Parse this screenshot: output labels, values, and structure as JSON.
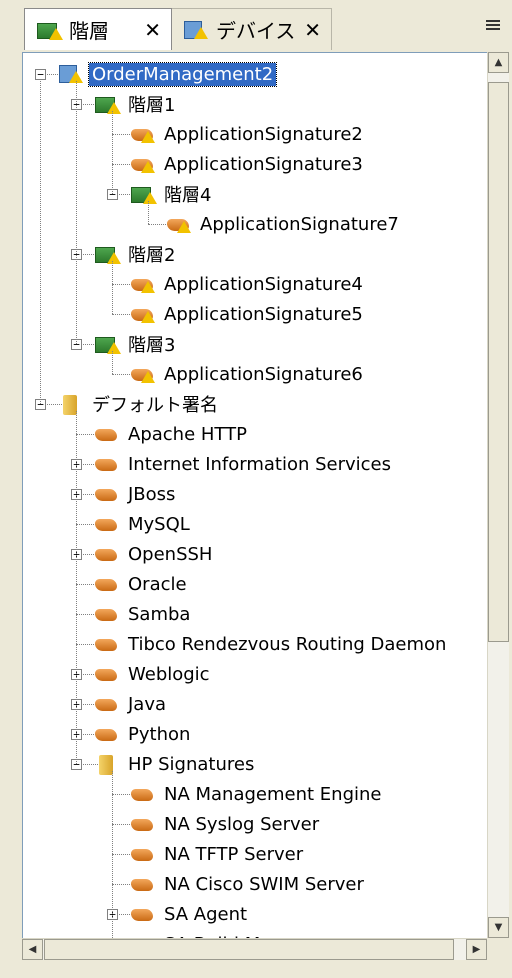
{
  "tabs": [
    {
      "label": "階層",
      "icon": "hierarchy-icon",
      "close": "✕"
    },
    {
      "label": "デバイス",
      "icon": "device-icon",
      "close": "✕"
    }
  ],
  "tree": [
    {
      "label": "OrderManagement2",
      "depth": 0,
      "icon": "root",
      "expand": "−",
      "selected": true
    },
    {
      "label": "階層1",
      "depth": 1,
      "icon": "stack",
      "expand": "−"
    },
    {
      "label": "ApplicationSignature2",
      "depth": 2,
      "icon": "sigwarn"
    },
    {
      "label": "ApplicationSignature3",
      "depth": 2,
      "icon": "sigwarn"
    },
    {
      "label": "階層4",
      "depth": 2,
      "icon": "stack",
      "expand": "−"
    },
    {
      "label": "ApplicationSignature7",
      "depth": 3,
      "icon": "sigwarn"
    },
    {
      "label": "階層2",
      "depth": 1,
      "icon": "stack",
      "expand": "−"
    },
    {
      "label": "ApplicationSignature4",
      "depth": 2,
      "icon": "sigwarn"
    },
    {
      "label": "ApplicationSignature5",
      "depth": 2,
      "icon": "sigwarn"
    },
    {
      "label": "階層3",
      "depth": 1,
      "icon": "stack",
      "expand": "−"
    },
    {
      "label": "ApplicationSignature6",
      "depth": 2,
      "icon": "sigwarn"
    },
    {
      "label": "デフォルト署名",
      "depth": 0,
      "icon": "folder",
      "expand": "−"
    },
    {
      "label": "Apache HTTP",
      "depth": 1,
      "icon": "sig"
    },
    {
      "label": "Internet Information Services",
      "depth": 1,
      "icon": "sig",
      "expand": "+"
    },
    {
      "label": "JBoss",
      "depth": 1,
      "icon": "sig",
      "expand": "+"
    },
    {
      "label": "MySQL",
      "depth": 1,
      "icon": "sig"
    },
    {
      "label": "OpenSSH",
      "depth": 1,
      "icon": "sig",
      "expand": "+"
    },
    {
      "label": "Oracle",
      "depth": 1,
      "icon": "sig"
    },
    {
      "label": "Samba",
      "depth": 1,
      "icon": "sig"
    },
    {
      "label": "Tibco Rendezvous Routing Daemon",
      "depth": 1,
      "icon": "sig"
    },
    {
      "label": "Weblogic",
      "depth": 1,
      "icon": "sig",
      "expand": "+"
    },
    {
      "label": "Java",
      "depth": 1,
      "icon": "sig",
      "expand": "+"
    },
    {
      "label": "Python",
      "depth": 1,
      "icon": "sig",
      "expand": "+"
    },
    {
      "label": "HP Signatures",
      "depth": 1,
      "icon": "folder",
      "expand": "−"
    },
    {
      "label": "NA Management Engine",
      "depth": 2,
      "icon": "sig"
    },
    {
      "label": "NA Syslog Server",
      "depth": 2,
      "icon": "sig"
    },
    {
      "label": "NA TFTP Server",
      "depth": 2,
      "icon": "sig"
    },
    {
      "label": "NA Cisco SWIM Server",
      "depth": 2,
      "icon": "sig"
    },
    {
      "label": "SA Agent",
      "depth": 2,
      "icon": "sig",
      "expand": "+"
    },
    {
      "label": "SA Build Manager",
      "depth": 2,
      "icon": "sig",
      "expand": "+"
    }
  ]
}
